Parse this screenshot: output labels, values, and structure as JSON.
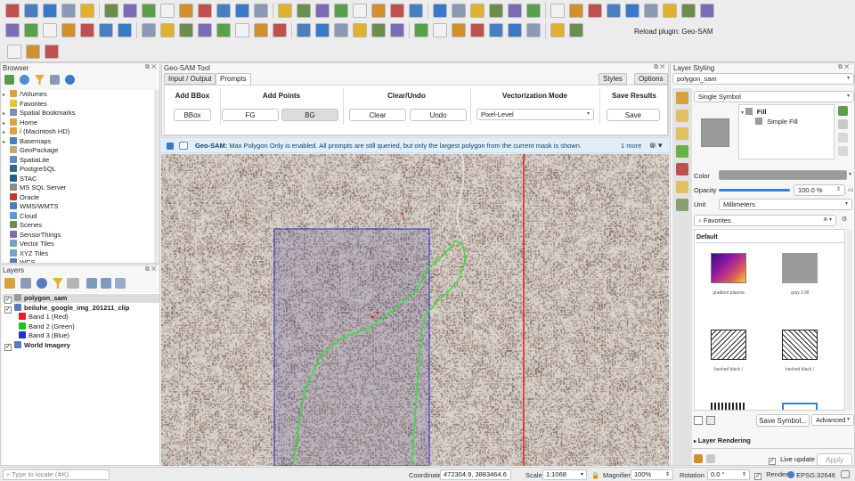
{
  "toolbar": {
    "reload_plugin_label": "Reload plugin: Geo-SAM"
  },
  "browser": {
    "title": "Browser",
    "items": [
      {
        "label": "/Volumes",
        "icon": "folder-icon",
        "color": "#d9a441",
        "arrow": "▸"
      },
      {
        "label": "Favorites",
        "icon": "star-icon",
        "color": "#e7c23a",
        "arrow": ""
      },
      {
        "label": "Spatial Bookmarks",
        "icon": "bookmark-icon",
        "color": "#7a8fb5",
        "arrow": "▸"
      },
      {
        "label": "Home",
        "icon": "folder-icon",
        "color": "#d9a441",
        "arrow": "▸"
      },
      {
        "label": "/ (Macintosh HD)",
        "icon": "folder-icon",
        "color": "#d9a441",
        "arrow": "▸"
      },
      {
        "label": "Basemaps",
        "icon": "globe-icon",
        "color": "#4a7fbf",
        "arrow": "▸"
      },
      {
        "label": "GeoPackage",
        "icon": "geopackage-icon",
        "color": "#c9a66b",
        "arrow": ""
      },
      {
        "label": "SpatiaLite",
        "icon": "feather-icon",
        "color": "#5a8ec4",
        "arrow": ""
      },
      {
        "label": "PostgreSQL",
        "icon": "elephant-icon",
        "color": "#336791",
        "arrow": ""
      },
      {
        "label": "STAC",
        "icon": "stac-icon",
        "color": "#2c5e8a",
        "arrow": ""
      },
      {
        "label": "MS SQL Server",
        "icon": "database-icon",
        "color": "#8a8a8a",
        "arrow": ""
      },
      {
        "label": "Oracle",
        "icon": "database-icon",
        "color": "#c0392b",
        "arrow": ""
      },
      {
        "label": "WMS/WMTS",
        "icon": "globe-icon",
        "color": "#4a7fbf",
        "arrow": ""
      },
      {
        "label": "Cloud",
        "icon": "cloud-icon",
        "color": "#5b9bd5",
        "arrow": ""
      },
      {
        "label": "Scenes",
        "icon": "scene-icon",
        "color": "#6b8e4e",
        "arrow": ""
      },
      {
        "label": "SensorThings",
        "icon": "sensor-icon",
        "color": "#7c6bb5",
        "arrow": ""
      },
      {
        "label": "Vector Tiles",
        "icon": "grid-icon",
        "color": "#7a9fbf",
        "arrow": ""
      },
      {
        "label": "XYZ Tiles",
        "icon": "grid-icon",
        "color": "#7a9fbf",
        "arrow": ""
      },
      {
        "label": "WCS",
        "icon": "globe-icon",
        "color": "#4a7fbf",
        "arrow": ""
      }
    ]
  },
  "layers": {
    "title": "Layers",
    "items": [
      {
        "label": "polygon_sam",
        "indent": 0,
        "bold": true,
        "checked": true,
        "swatch": "#9a9a9a",
        "selected": true
      },
      {
        "label": "beiluhe_google_img_201211_clip",
        "indent": 0,
        "bold": true,
        "checked": true,
        "swatch": "#5a7bbf",
        "selected": false
      },
      {
        "label": "Band 1 (Red)",
        "indent": 2,
        "bold": false,
        "checked": false,
        "swatch": "#e02020",
        "selected": false
      },
      {
        "label": "Band 2 (Green)",
        "indent": 2,
        "bold": false,
        "checked": false,
        "swatch": "#20c020",
        "selected": false
      },
      {
        "label": "Band 3 (Blue)",
        "indent": 2,
        "bold": false,
        "checked": false,
        "swatch": "#2030d0",
        "selected": false
      },
      {
        "label": "World Imagery",
        "indent": 0,
        "bold": true,
        "checked": true,
        "swatch": "#5a7bbf",
        "selected": false
      }
    ]
  },
  "geosam": {
    "title": "Geo-SAM Tool",
    "tabs": [
      "Input / Output",
      "Prompts"
    ],
    "active_tab": 1,
    "right_tabs": [
      "Styles",
      "Options"
    ],
    "sections": {
      "add_bbox": {
        "header": "Add BBox",
        "button": "BBox"
      },
      "add_points": {
        "header": "Add Points",
        "fg": "FG",
        "bg": "BG"
      },
      "clear_undo": {
        "header": "Clear/Undo",
        "clear": "Clear",
        "undo": "Undo"
      },
      "vectorization": {
        "header": "Vectorization Mode",
        "value": "Pixel-Level"
      },
      "save_results": {
        "header": "Save Results",
        "button": "Save"
      }
    },
    "info": {
      "prefix": "Geo-SAM:",
      "message": "Max Polygon Only is enabled. All prompts are still queried, but only the largest polygon from the current mask is shown.",
      "more": "1 more"
    }
  },
  "styling": {
    "title": "Layer Styling",
    "layer": "polygon_sam",
    "renderer": "Single Symbol",
    "tree": {
      "fill": "Fill",
      "simple_fill": "Simple Fill"
    },
    "color_label": "Color",
    "opacity_label": "Opacity",
    "opacity_value": "100.0 %",
    "opacity_fraction": 1.0,
    "unit_label": "Unit",
    "unit_value": "Millimeters",
    "favorites_label": "Favorites",
    "default_label": "Default",
    "symbols": [
      {
        "caption": "gradient  plasma",
        "kind": "gradient"
      },
      {
        "caption": "gray 3 fill",
        "kind": "gray"
      },
      {
        "caption": "hashed black /",
        "kind": "hatch"
      },
      {
        "caption": "hashed black \\",
        "kind": "hatch2"
      }
    ],
    "save_symbol": "Save Symbol...",
    "advanced": "Advanced",
    "layer_rendering": "Layer Rendering",
    "live_update": "Live update",
    "apply": "Apply",
    "symbol_color": "#9b9b9b"
  },
  "status": {
    "locate_placeholder": "Type to locate (⌘K)",
    "coordinate_label": "Coordinate",
    "coordinate_value": "472304.9, 3883464.6",
    "scale_label": "Scale",
    "scale_value": "1:1068",
    "magnifier_label": "Magnifier",
    "magnifier_value": "100%",
    "rotation_label": "Rotation",
    "rotation_value": "0.0 °",
    "render_label": "Render",
    "crs": "EPSG:32646"
  },
  "colors": {
    "bbox": "#2a2ad0",
    "polygon": "#38e038",
    "red_line": "#e02020"
  }
}
